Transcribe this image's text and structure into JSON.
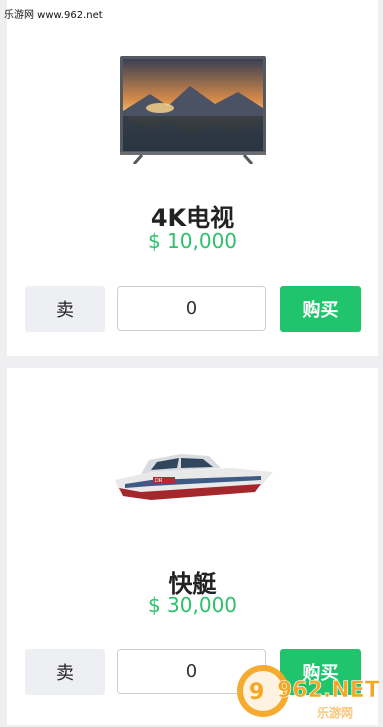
{
  "watermark": {
    "site_text": "乐游网 www.962.net",
    "logo_text": "962.NET",
    "logo_subtext": "乐游网"
  },
  "products": [
    {
      "name": "4K电视",
      "price": "$ 10,000",
      "quantity": "0",
      "sell_label": "卖",
      "buy_label": "购买",
      "image": "tv-icon"
    },
    {
      "name": "快艇",
      "price": "$ 30,000",
      "quantity": "0",
      "sell_label": "卖",
      "buy_label": "购买",
      "image": "speedboat-icon"
    }
  ],
  "colors": {
    "price": "#2cc16c",
    "buy_button": "#1fc46d",
    "sell_button": "#eeeff2",
    "background": "#efeff1"
  }
}
